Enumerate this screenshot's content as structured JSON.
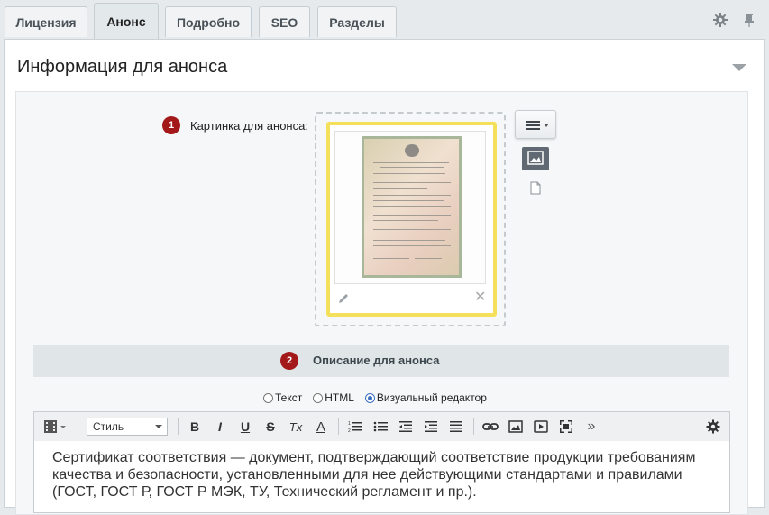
{
  "tabs": [
    {
      "label": "Лицензия",
      "active": false
    },
    {
      "label": "Анонс",
      "active": true
    },
    {
      "label": "Подробно",
      "active": false
    },
    {
      "label": "SEO",
      "active": false
    },
    {
      "label": "Разделы",
      "active": false
    }
  ],
  "tab_tools": {
    "settings_icon": "gear-icon",
    "pin_icon": "pin-icon"
  },
  "section": {
    "title": "Информация для анонса"
  },
  "preview_picture": {
    "badge": "1",
    "label": "Картинка для анонса:",
    "actions": {
      "menu_icon": "hamburger-menu-icon",
      "image_icon": "image-icon",
      "file_icon": "file-icon"
    },
    "edit_icon": "pencil-icon",
    "remove_label": "✕"
  },
  "description": {
    "badge": "2",
    "title": "Описание для анонса",
    "modes": [
      {
        "label": "Текст",
        "selected": false
      },
      {
        "label": "HTML",
        "selected": false
      },
      {
        "label": "Визуальный редактор",
        "selected": true
      }
    ],
    "toolbar": {
      "style_select": "Стиль",
      "bold": "B",
      "italic": "I",
      "underline": "U",
      "strike": "S",
      "clear_format": "Tx",
      "font_color": "A",
      "more": "»"
    },
    "text": "Сертификат соответствия — документ, подтверждающий соответствие продукции требованиям качества и безопасности, установленными для нее действующими стандартами и правилами (ГОСТ, ГОСТ Р, ГОСТ Р МЭК, ТУ, Технический регламент и пр.)."
  },
  "colors": {
    "badge": "#a3191a",
    "thumb_border": "#f5e05b",
    "radio_accent": "#3b6fc1"
  }
}
